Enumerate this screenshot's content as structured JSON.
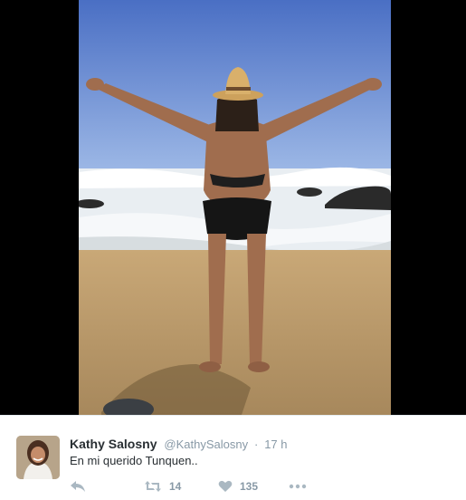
{
  "media": {
    "icon": "photo-image"
  },
  "tweet": {
    "author_name": "Kathy Salosny",
    "handle": "@KathySalosny",
    "separator": "·",
    "time": "17 h",
    "text": "En mi querido Tunquen..",
    "avatar_icon": "user-avatar"
  },
  "actions": {
    "reply_icon": "reply-icon",
    "retweet_icon": "retweet-icon",
    "retweet_count": "14",
    "like_icon": "heart-icon",
    "like_count": "135",
    "more_icon": "more-dots-icon"
  }
}
